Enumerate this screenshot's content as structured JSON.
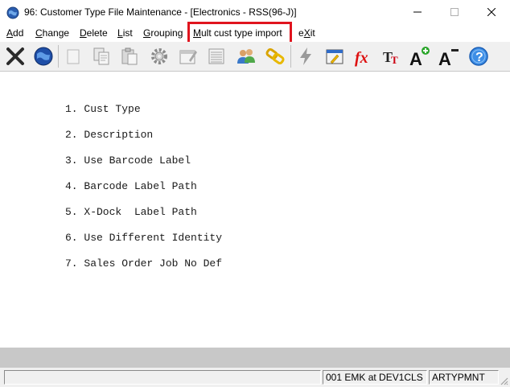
{
  "window": {
    "title": "96: Customer Type File Maintenance - [Electronics - RSS(96-J)]"
  },
  "menu": {
    "items": [
      {
        "label": "Add",
        "accel": "A",
        "rest": "dd"
      },
      {
        "label": "Change",
        "accel": "C",
        "rest": "hange"
      },
      {
        "label": "Delete",
        "accel": "D",
        "rest": "elete"
      },
      {
        "label": "List",
        "accel": "L",
        "rest": "ist"
      },
      {
        "label": "Grouping",
        "accel": "G",
        "rest": "rouping"
      },
      {
        "label": "Mult cust type import",
        "accel": "M",
        "rest": "ult cust type import"
      },
      {
        "label": "eXit",
        "pre": "e",
        "accel": "X",
        "rest": "it"
      }
    ]
  },
  "toolbar": {
    "icons": [
      "close-x-icon",
      "globe-icon",
      "blank-page-icon",
      "copy-icon",
      "paste-icon",
      "settings-gear-icon",
      "edit-window-icon",
      "list-icon",
      "users-icon",
      "link-chain-icon",
      "lightning-icon",
      "edit-screen-icon",
      "function-fx-icon",
      "text-format-icon",
      "font-increase-icon",
      "font-decrease-icon",
      "help-icon"
    ]
  },
  "fields": [
    "1. Cust Type",
    "2. Description",
    "3. Use Barcode Label",
    "4. Barcode Label Path",
    "5. X-Dock  Label Path",
    "6. Use Different Identity",
    "7. Sales Order Job No Def"
  ],
  "status": {
    "panel1": "",
    "panel2": "001 EMK at DEV1CLS",
    "panel3": "ARTYPMNT"
  },
  "colors": {
    "highlight": "#e0141e",
    "toolbar_bg": "#f0f0f0",
    "gray_band": "#c8c8c8"
  }
}
